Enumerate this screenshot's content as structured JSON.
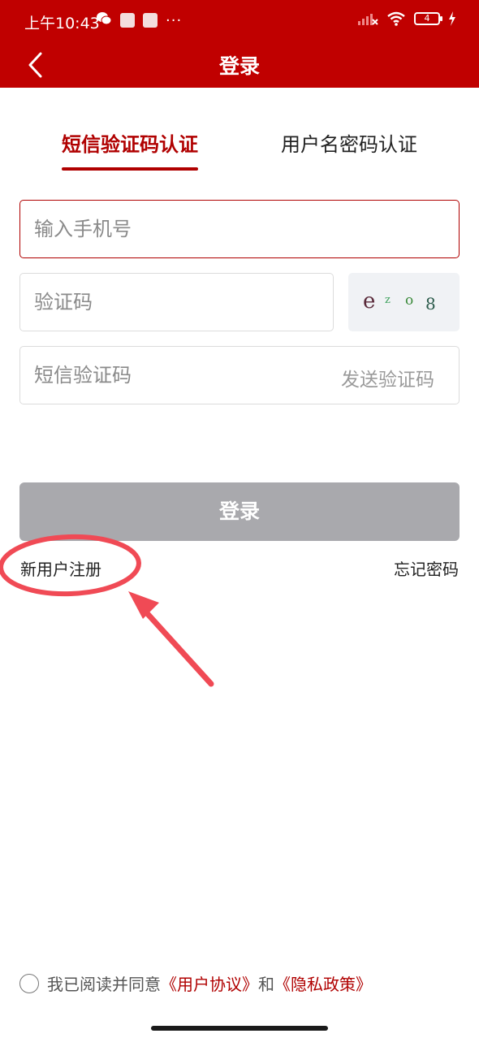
{
  "status_bar": {
    "time": "上午10:43",
    "dots": "···",
    "battery_level": "4",
    "icons": [
      "wechat-icon",
      "notification-icon",
      "signal-icon",
      "wifi-icon",
      "battery-icon",
      "charging-icon"
    ]
  },
  "header": {
    "title": "登录",
    "back_icon": "chevron-left-icon",
    "background_color": "#c00000"
  },
  "tabs": [
    {
      "label": "短信验证码认证",
      "active": true
    },
    {
      "label": "用户名密码认证",
      "active": false
    }
  ],
  "form": {
    "phone_placeholder": "输入手机号",
    "captcha_placeholder": "验证码",
    "captcha_image_text": [
      "e",
      "z",
      "o",
      "8"
    ],
    "sms_placeholder": "短信验证码",
    "send_code_label": "发送验证码"
  },
  "actions": {
    "login_label": "登录",
    "register_label": "新用户注册",
    "forgot_label": "忘记密码"
  },
  "agreement": {
    "prefix": "我已阅读并同意",
    "user_agreement": "《用户协议》",
    "connector": "和",
    "privacy_policy": "《隐私政策》",
    "checked": false
  },
  "colors": {
    "brand_red": "#c00000",
    "accent_red": "#b00000",
    "disabled_button": "#a9a9ad",
    "annotation_red": "#f04a55"
  }
}
